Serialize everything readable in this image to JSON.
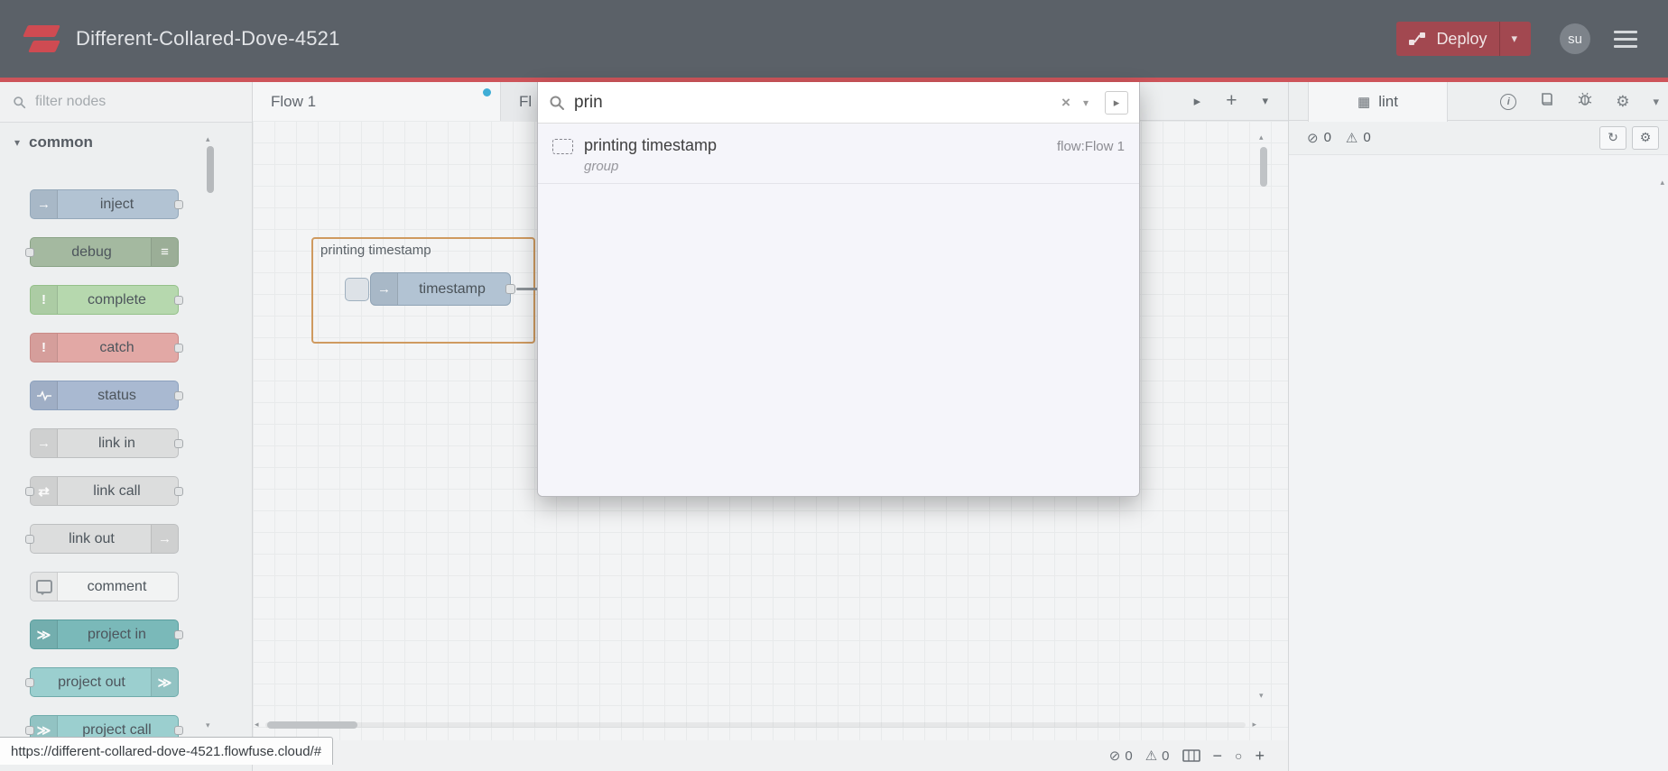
{
  "header": {
    "title": "Different-Collared-Dove-4521",
    "deploy_label": "Deploy",
    "avatar_text": "su"
  },
  "palette": {
    "filter_placeholder": "filter nodes",
    "category_label": "common",
    "nodes": [
      {
        "label": "inject",
        "bg": "#b2c3d3",
        "border": "#94a8ba",
        "icon": "→",
        "icon_side": "left",
        "ports": "right"
      },
      {
        "label": "debug",
        "bg": "#a4b9a0",
        "border": "#8aa386",
        "icon": "≡",
        "icon_side": "right",
        "ports": "left"
      },
      {
        "label": "complete",
        "bg": "#b6d8ae",
        "border": "#94c089",
        "icon": "!",
        "icon_side": "left",
        "ports": "right"
      },
      {
        "label": "catch",
        "bg": "#e2a8a5",
        "border": "#c98a87",
        "icon": "!",
        "icon_side": "left",
        "ports": "right"
      },
      {
        "label": "status",
        "bg": "#a9b9d1",
        "border": "#8ba0bd",
        "icon": "pulse",
        "icon_side": "left",
        "ports": "right"
      },
      {
        "label": "link in",
        "bg": "#dcdddd",
        "border": "#bdbfc0",
        "icon": "→",
        "icon_side": "left",
        "ports": "right"
      },
      {
        "label": "link call",
        "bg": "#dcdddd",
        "border": "#bdbfc0",
        "icon": "⇄",
        "icon_side": "left",
        "ports": "both"
      },
      {
        "label": "link out",
        "bg": "#dcdddd",
        "border": "#bdbfc0",
        "icon": "→",
        "icon_side": "right",
        "ports": "left"
      },
      {
        "label": "comment",
        "bg": "#f2f3f3",
        "border": "#c8cacc",
        "icon": "bubble",
        "icon_side": "left",
        "ports": "none"
      },
      {
        "label": "project in",
        "bg": "#7ab9b9",
        "border": "#5a9e9e",
        "icon": "≫",
        "icon_side": "left",
        "ports": "right"
      },
      {
        "label": "project out",
        "bg": "#9bcfcf",
        "border": "#6fabab",
        "icon": "≫",
        "icon_side": "right",
        "ports": "left"
      },
      {
        "label": "project call",
        "bg": "#9bcfcf",
        "border": "#6fabab",
        "icon": "≫",
        "icon_side": "left",
        "ports": "both"
      }
    ]
  },
  "workspace": {
    "tabs": [
      {
        "label": "Flow 1",
        "active": true,
        "dirty": true
      },
      {
        "label": "Fl",
        "active": false,
        "dirty": false
      }
    ]
  },
  "canvas": {
    "group_label": "printing timestamp",
    "inject_label": "timestamp"
  },
  "search": {
    "query": "prin",
    "results": [
      {
        "title": "printing timestamp",
        "subtitle": "group",
        "flow": "flow:Flow 1"
      }
    ]
  },
  "sidebar": {
    "tab_label": "lint",
    "error_count": "0",
    "warning_count": "0"
  },
  "footer": {
    "error_count": "0",
    "warning_count": "0",
    "zoom_out": "−",
    "zoom_reset": "○",
    "zoom_in": "+"
  },
  "browser": {
    "status_url": "https://different-collared-dove-4521.flowfuse.cloud/#"
  },
  "icons": {
    "error": "⊘",
    "warning": "⚠",
    "refresh": "↻",
    "gear": "⚙",
    "caret_down": "▾",
    "tab_next": "▸",
    "tab_add": "+",
    "tab_list": "▾",
    "clear": "×",
    "advanced": "▸",
    "lint_tab": "▦",
    "info": "i",
    "scroll_up": "▴",
    "scroll_down": "▾",
    "scroll_left": "◂",
    "scroll_right": "▸"
  },
  "colors": {
    "accent": "#cd545a",
    "deploy": "#a24850",
    "header_bg": "#5b6168",
    "tab_dirty_dot": "#3fadd6",
    "group_border": "#cf9a60"
  }
}
